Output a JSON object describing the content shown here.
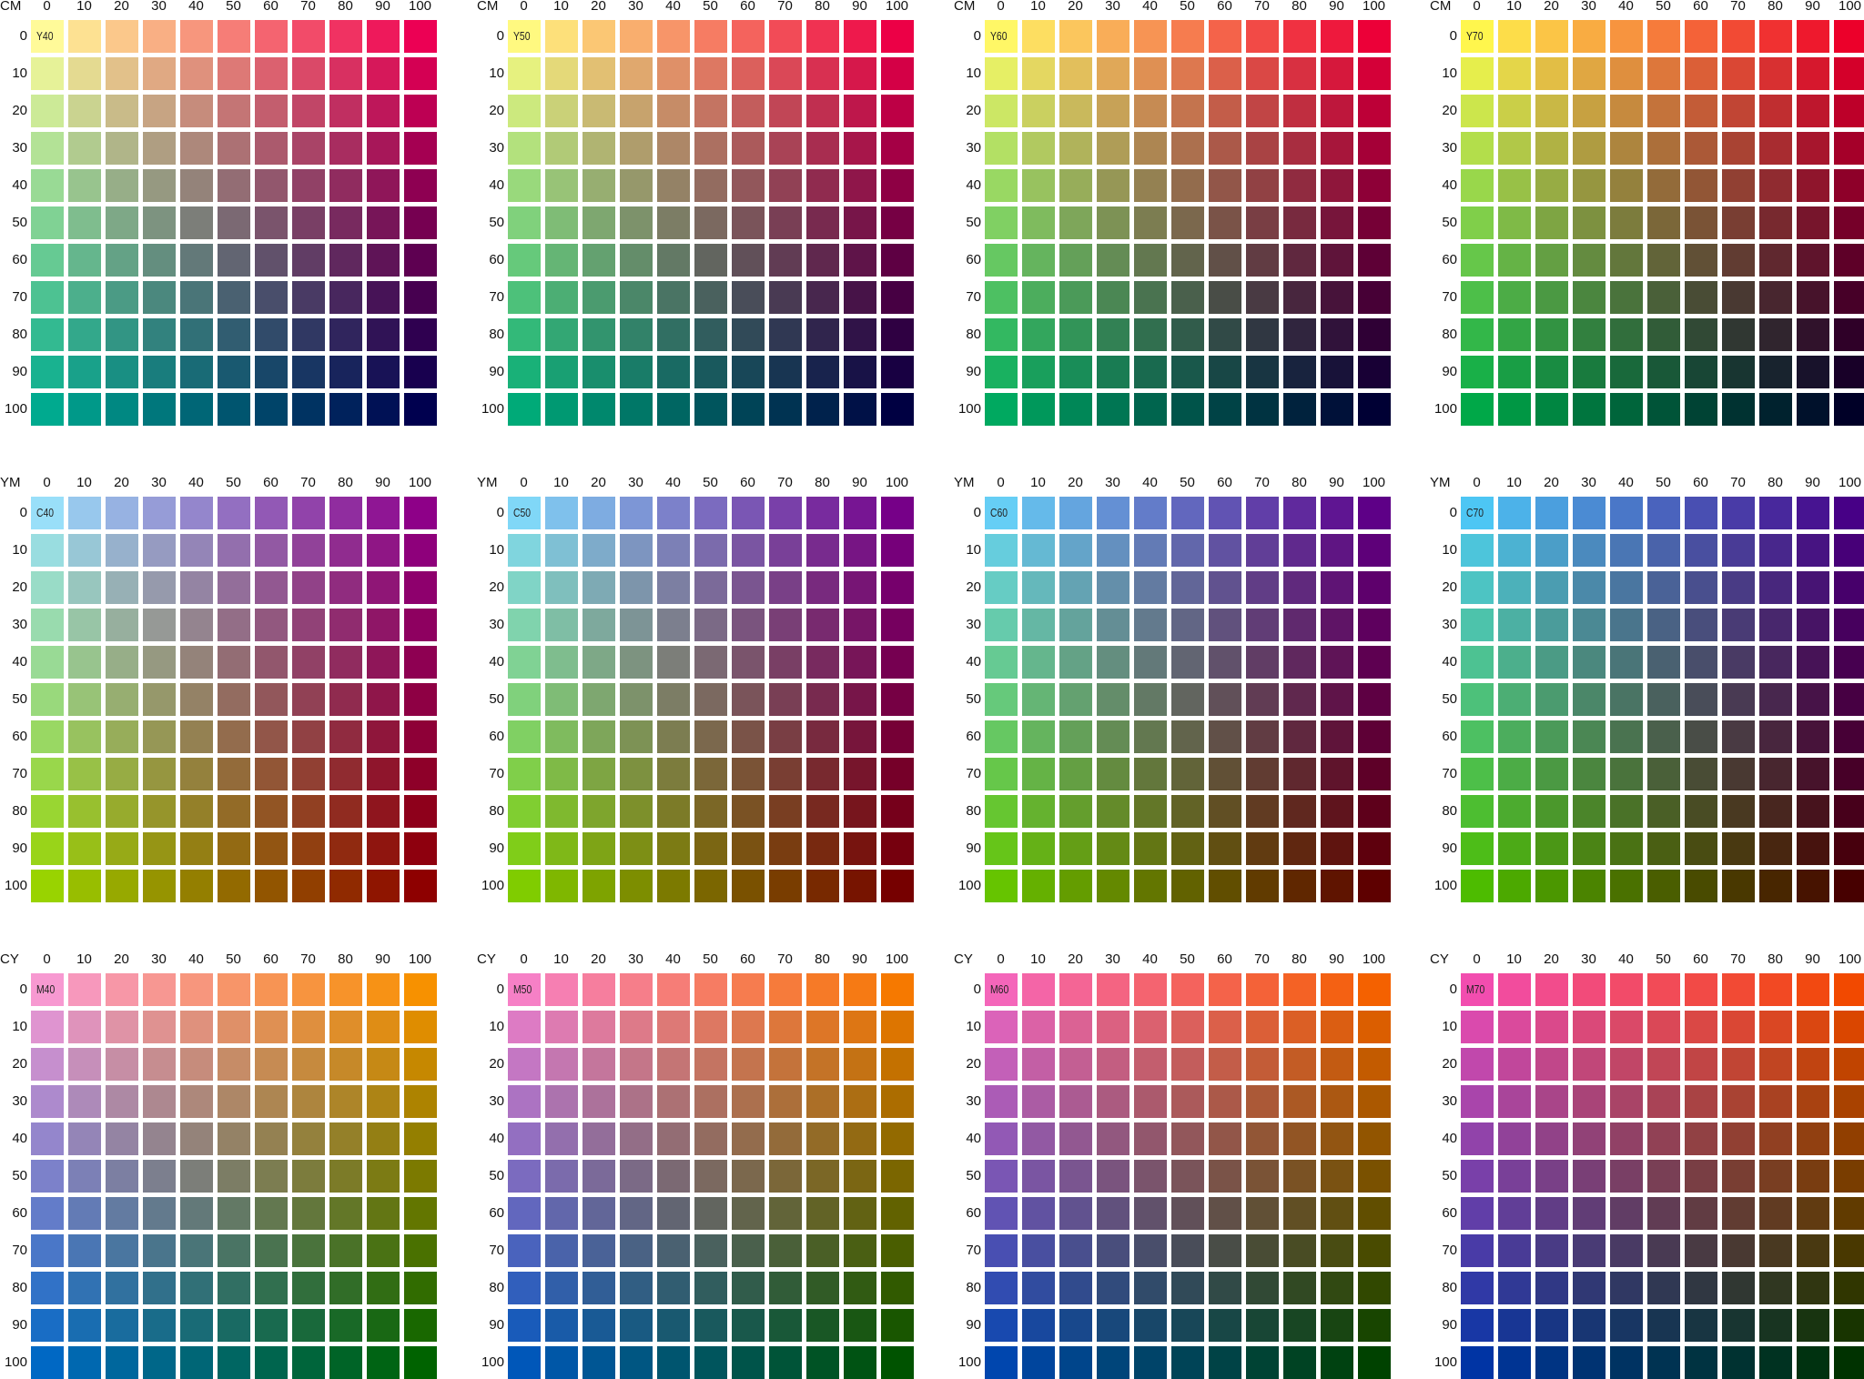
{
  "charts": [
    {
      "corner_label": "CM",
      "swatch_label": "Y40",
      "row_var": "C",
      "col_var": "M",
      "fixed_var": "Y",
      "fixed_value": 40,
      "columns": [
        "0",
        "10",
        "20",
        "30",
        "40",
        "50",
        "60",
        "70",
        "80",
        "90",
        "100"
      ],
      "rows": [
        "0",
        "10",
        "20",
        "30",
        "40",
        "50",
        "60",
        "70",
        "80",
        "90",
        "100"
      ]
    },
    {
      "corner_label": "CM",
      "swatch_label": "Y50",
      "row_var": "C",
      "col_var": "M",
      "fixed_var": "Y",
      "fixed_value": 50,
      "columns": [
        "0",
        "10",
        "20",
        "30",
        "40",
        "50",
        "60",
        "70",
        "80",
        "90",
        "100"
      ],
      "rows": [
        "0",
        "10",
        "20",
        "30",
        "40",
        "50",
        "60",
        "70",
        "80",
        "90",
        "100"
      ]
    },
    {
      "corner_label": "CM",
      "swatch_label": "Y60",
      "row_var": "C",
      "col_var": "M",
      "fixed_var": "Y",
      "fixed_value": 60,
      "columns": [
        "0",
        "10",
        "20",
        "30",
        "40",
        "50",
        "60",
        "70",
        "80",
        "90",
        "100"
      ],
      "rows": [
        "0",
        "10",
        "20",
        "30",
        "40",
        "50",
        "60",
        "70",
        "80",
        "90",
        "100"
      ]
    },
    {
      "corner_label": "CM",
      "swatch_label": "Y70",
      "row_var": "C",
      "col_var": "M",
      "fixed_var": "Y",
      "fixed_value": 70,
      "columns": [
        "0",
        "10",
        "20",
        "30",
        "40",
        "50",
        "60",
        "70",
        "80",
        "90",
        "100"
      ],
      "rows": [
        "0",
        "10",
        "20",
        "30",
        "40",
        "50",
        "60",
        "70",
        "80",
        "90",
        "100"
      ]
    },
    {
      "corner_label": "YM",
      "swatch_label": "C40",
      "row_var": "Y",
      "col_var": "M",
      "fixed_var": "C",
      "fixed_value": 40,
      "columns": [
        "0",
        "10",
        "20",
        "30",
        "40",
        "50",
        "60",
        "70",
        "80",
        "90",
        "100"
      ],
      "rows": [
        "0",
        "10",
        "20",
        "30",
        "40",
        "50",
        "60",
        "70",
        "80",
        "90",
        "100"
      ]
    },
    {
      "corner_label": "YM",
      "swatch_label": "C50",
      "row_var": "Y",
      "col_var": "M",
      "fixed_var": "C",
      "fixed_value": 50,
      "columns": [
        "0",
        "10",
        "20",
        "30",
        "40",
        "50",
        "60",
        "70",
        "80",
        "90",
        "100"
      ],
      "rows": [
        "0",
        "10",
        "20",
        "30",
        "40",
        "50",
        "60",
        "70",
        "80",
        "90",
        "100"
      ]
    },
    {
      "corner_label": "YM",
      "swatch_label": "C60",
      "row_var": "Y",
      "col_var": "M",
      "fixed_var": "C",
      "fixed_value": 60,
      "columns": [
        "0",
        "10",
        "20",
        "30",
        "40",
        "50",
        "60",
        "70",
        "80",
        "90",
        "100"
      ],
      "rows": [
        "0",
        "10",
        "20",
        "30",
        "40",
        "50",
        "60",
        "70",
        "80",
        "90",
        "100"
      ]
    },
    {
      "corner_label": "YM",
      "swatch_label": "C70",
      "row_var": "Y",
      "col_var": "M",
      "fixed_var": "C",
      "fixed_value": 70,
      "columns": [
        "0",
        "10",
        "20",
        "30",
        "40",
        "50",
        "60",
        "70",
        "80",
        "90",
        "100"
      ],
      "rows": [
        "0",
        "10",
        "20",
        "30",
        "40",
        "50",
        "60",
        "70",
        "80",
        "90",
        "100"
      ]
    },
    {
      "corner_label": "CY",
      "swatch_label": "M40",
      "row_var": "C",
      "col_var": "Y",
      "fixed_var": "M",
      "fixed_value": 40,
      "columns": [
        "0",
        "10",
        "20",
        "30",
        "40",
        "50",
        "60",
        "70",
        "80",
        "90",
        "100"
      ],
      "rows": [
        "0",
        "10",
        "20",
        "30",
        "40",
        "50",
        "60",
        "70",
        "80",
        "90",
        "100"
      ]
    },
    {
      "corner_label": "CY",
      "swatch_label": "M50",
      "row_var": "C",
      "col_var": "Y",
      "fixed_var": "M",
      "fixed_value": 50,
      "columns": [
        "0",
        "10",
        "20",
        "30",
        "40",
        "50",
        "60",
        "70",
        "80",
        "90",
        "100"
      ],
      "rows": [
        "0",
        "10",
        "20",
        "30",
        "40",
        "50",
        "60",
        "70",
        "80",
        "90",
        "100"
      ]
    },
    {
      "corner_label": "CY",
      "swatch_label": "M60",
      "row_var": "C",
      "col_var": "Y",
      "fixed_var": "M",
      "fixed_value": 60,
      "columns": [
        "0",
        "10",
        "20",
        "30",
        "40",
        "50",
        "60",
        "70",
        "80",
        "90",
        "100"
      ],
      "rows": [
        "0",
        "10",
        "20",
        "30",
        "40",
        "50",
        "60",
        "70",
        "80",
        "90",
        "100"
      ]
    },
    {
      "corner_label": "CY",
      "swatch_label": "M70",
      "row_var": "C",
      "col_var": "Y",
      "fixed_var": "M",
      "fixed_value": 70,
      "columns": [
        "0",
        "10",
        "20",
        "30",
        "40",
        "50",
        "60",
        "70",
        "80",
        "90",
        "100"
      ],
      "rows": [
        "0",
        "10",
        "20",
        "30",
        "40",
        "50",
        "60",
        "70",
        "80",
        "90",
        "100"
      ]
    }
  ]
}
